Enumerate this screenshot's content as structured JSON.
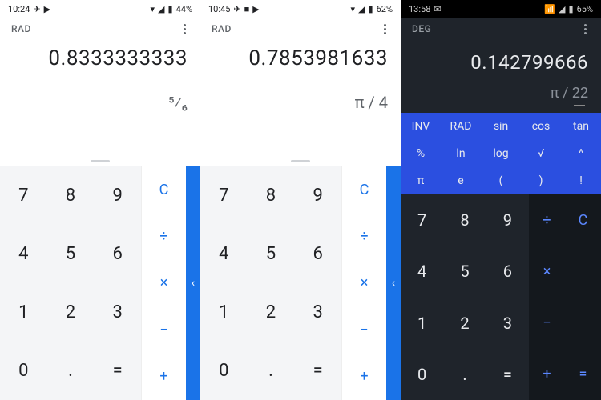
{
  "phones": [
    {
      "theme": "light",
      "status": {
        "time": "10:24",
        "icons_left": [
          "✈",
          "▶"
        ],
        "icons_right": [
          "▾",
          "◢",
          "▮"
        ],
        "battery_text": "44%"
      },
      "mode": "RAD",
      "result": "0.8333333333",
      "expression": "⁵⁄₆",
      "digits": [
        "7",
        "8",
        "9",
        "4",
        "5",
        "6",
        "1",
        "2",
        "3",
        "0",
        ".",
        "="
      ],
      "ops": [
        "C",
        "÷",
        "×",
        "−",
        "+"
      ],
      "edge_glyph": "‹"
    },
    {
      "theme": "light",
      "status": {
        "time": "10:45",
        "icons_left": [
          "✈",
          "■",
          "▶"
        ],
        "icons_right": [
          "▾",
          "◢",
          "▮"
        ],
        "battery_text": "62%"
      },
      "mode": "RAD",
      "result": "0.7853981633",
      "expression": "π / 4",
      "digits": [
        "7",
        "8",
        "9",
        "4",
        "5",
        "6",
        "1",
        "2",
        "3",
        "0",
        ".",
        "="
      ],
      "ops": [
        "C",
        "÷",
        "×",
        "−",
        "+"
      ],
      "edge_glyph": "‹"
    },
    {
      "theme": "dark",
      "status": {
        "time": "13:58",
        "icons_left": [
          "✉"
        ],
        "icons_right": [
          "📶",
          "◢",
          "▮"
        ],
        "battery_text": "65%"
      },
      "mode": "DEG",
      "result": "0.142799666",
      "expression": "π / 22",
      "advanced": [
        [
          "INV",
          "RAD",
          "sin",
          "cos",
          "tan"
        ],
        [
          "%",
          "ln",
          "log",
          "√",
          "^"
        ],
        [
          "π",
          "e",
          "(",
          ")",
          "!"
        ]
      ],
      "digits": [
        "7",
        "8",
        "9",
        "4",
        "5",
        "6",
        "1",
        "2",
        "3",
        "0",
        ".",
        "="
      ],
      "ops_grid": [
        "÷",
        "C",
        "×",
        "",
        "−",
        "",
        "+",
        "="
      ]
    }
  ]
}
